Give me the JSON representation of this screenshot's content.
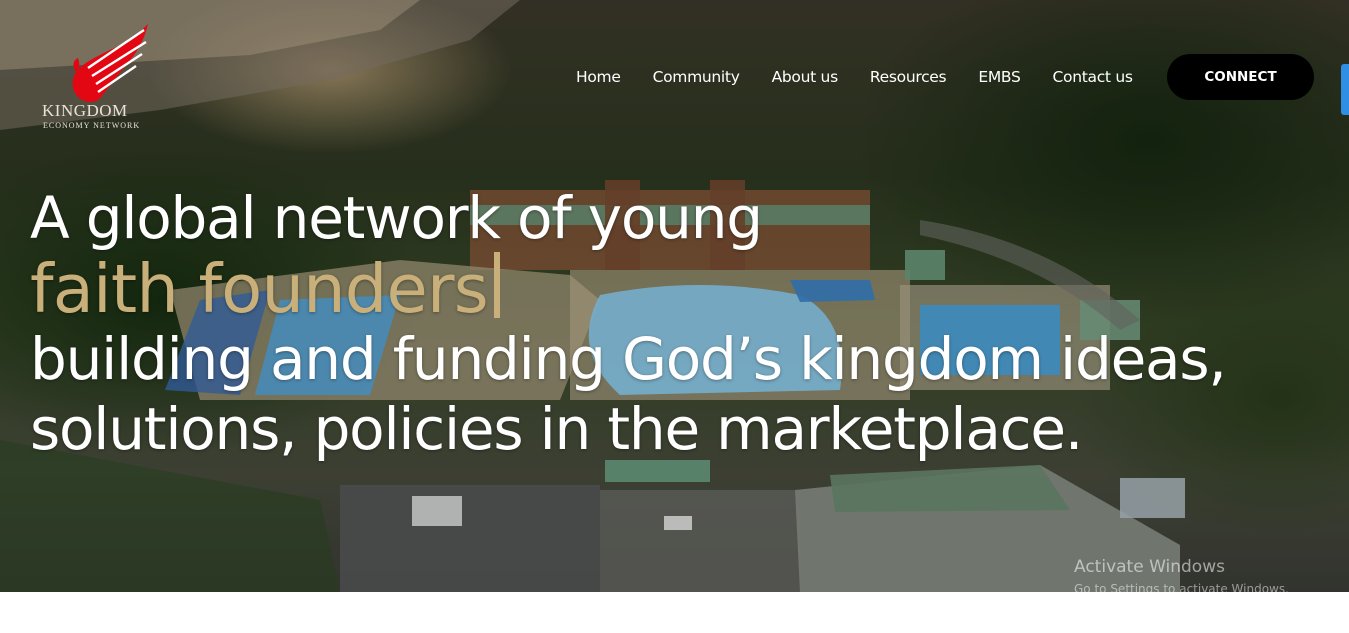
{
  "brand": {
    "logo_icon": "winged-eagle-logo",
    "name": "KINGDOM",
    "tagline": "ECONOMY NETWORK",
    "accent_color": "#e30613"
  },
  "nav": {
    "items": [
      {
        "label": "Home"
      },
      {
        "label": "Community"
      },
      {
        "label": "About us"
      },
      {
        "label": "Resources"
      },
      {
        "label": "EMBS"
      },
      {
        "label": "Contact us"
      }
    ],
    "cta_label": "CONNECT"
  },
  "hero": {
    "line1": "A global network of young",
    "line2": "faith founders",
    "line3": "building and funding God’s kingdom ideas,",
    "line4": "solutions, policies in the marketplace.",
    "highlight_color": "#c9b07a",
    "background": "aerial photo of park with swimming pools"
  },
  "watermark": {
    "title": "Activate Windows",
    "subtitle": "Go to Settings to activate Windows."
  }
}
